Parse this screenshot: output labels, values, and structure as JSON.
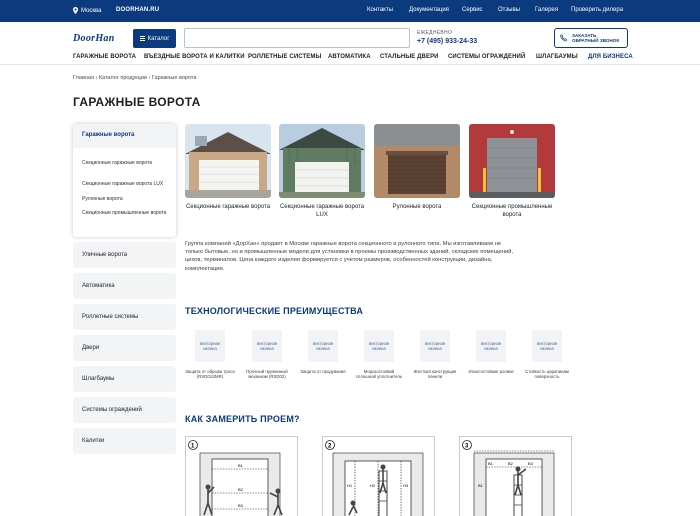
{
  "topbar": {
    "city": "Москва",
    "site": "DOORHAN.RU",
    "links": [
      "Контакты",
      "Документация",
      "Сервис",
      "Отзывы",
      "Галерея",
      "Проверить дилера"
    ]
  },
  "header": {
    "logo": "DoorHan",
    "catalog_label": "Каталог",
    "search_placeholder": "",
    "hours_label": "ЕЖЕДНЕВНО",
    "phone": "+7 (495) 933-24-33",
    "callback_line1": "ЗАКАЗАТЬ",
    "callback_line2": "ОБРАТНЫЙ ЗВОНОК"
  },
  "nav": [
    "ГАРАЖНЫЕ ВОРОТА",
    "ВЪЕЗДНЫЕ ВОРОТА И КАЛИТКИ",
    "РОЛЛЕТНЫЕ СИСТЕМЫ",
    "АВТОМАТИКА",
    "СТАЛЬНЫЕ ДВЕРИ",
    "СИСТЕМЫ ОГРАЖДЕНИЙ",
    "ШЛАГБАУМЫ",
    "ДЛЯ БИЗНЕСА"
  ],
  "breadcrumbs": "Главная › Каталог продукции › Гаражные ворота",
  "page_title": "ГАРАЖНЫЕ ВОРОТА",
  "sidebar": {
    "active": {
      "title": "Гаражные ворота",
      "items": [
        "Секционные гаражные ворота",
        "Секционные гаражные ворота LUX",
        "Рулонные ворота",
        "Секционные промышленные ворота"
      ]
    },
    "items": [
      "Уличные ворота",
      "Автоматика",
      "Роллетные системы",
      "Двери",
      "Шлагбаумы",
      "Системы ограждений",
      "Калитки"
    ]
  },
  "products": [
    {
      "caption": "Секционные гаражные ворота"
    },
    {
      "caption": "Секционные гаражные ворота LUX"
    },
    {
      "caption": "Рулонные ворота"
    },
    {
      "caption": "Секционные промышленные ворота"
    }
  ],
  "intro": "Группа компаний «ДорХан» продает в Москве гаражные ворота секционного и рулонного типа. Мы изготавливаем не только бытовые, но и промышленные модели для установки в проемы производственных зданий, складских помещений, цехов, терминалов. Цена каждого изделия формируется с учетом размеров, особенностей конструкции, дизайна, комплектации.",
  "features": {
    "title": "ТЕХНОЛОГИЧЕСКИЕ ПРЕИМУЩЕСТВА",
    "placeholder": "векторная иконка",
    "items": [
      "Защита от обрыва троса (RSD01SMR)",
      "Прочный пружинный механизм (RSD02)",
      "Защита от продувания",
      "Морозостойкий сплошной уплотнитель",
      "Жесткая конструкция панели",
      "Износостойкие ролики",
      "Стойкость царапинам поверхность"
    ]
  },
  "measure": {
    "title": "КАК ЗАМЕРИТЬ ПРОЕМ?",
    "steps": [
      "1",
      "2",
      "3"
    ]
  },
  "colors": {
    "brand": "#0b3a7e",
    "sidebar_bg": "#f3f4f6"
  }
}
